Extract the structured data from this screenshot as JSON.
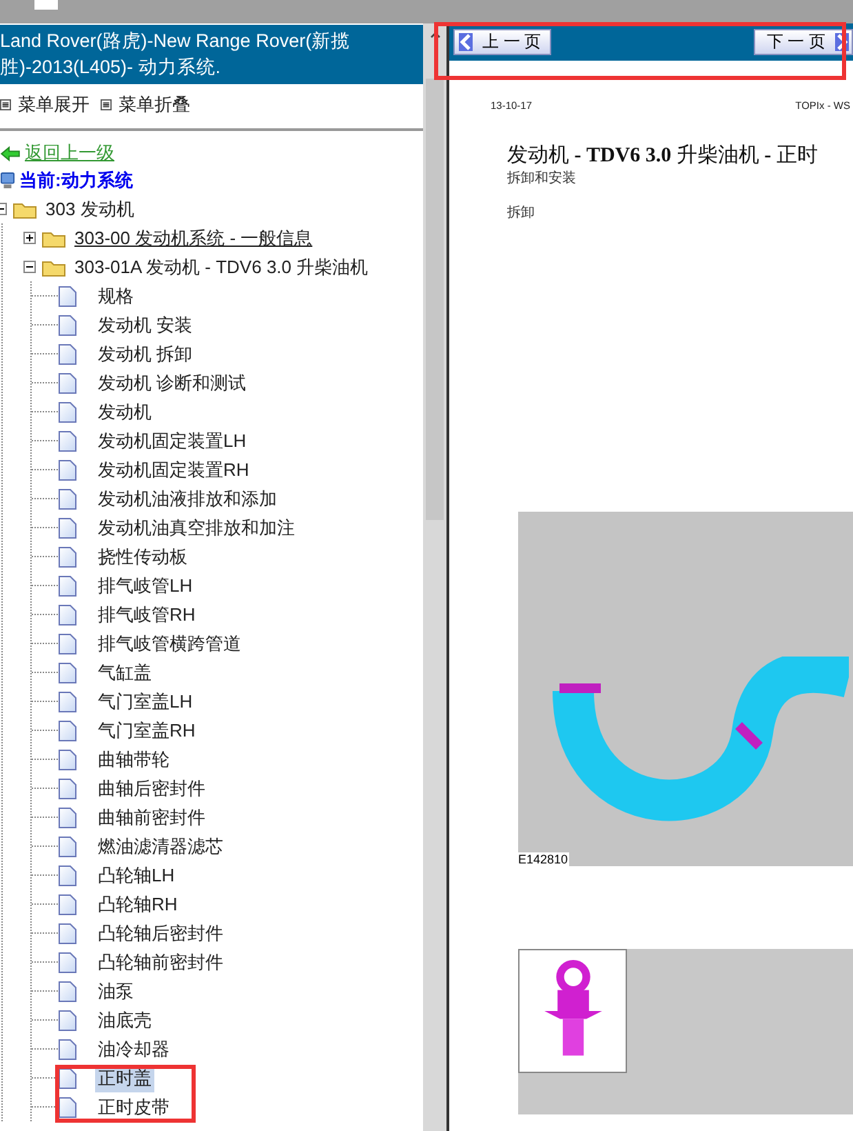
{
  "header": {
    "lines": [
      "Land Rover(路虎)-New Range Rover(新揽",
      "胜)-2013(L405)- 动力系统."
    ]
  },
  "menu_actions": [
    {
      "label": "菜单展开"
    },
    {
      "label": "菜单折叠"
    }
  ],
  "back_link": "返回上一级",
  "current": "当前:动力系统",
  "tree": [
    {
      "label": "303 发动机",
      "expanded": true,
      "underlined": false,
      "children": [
        {
          "label": "303-00 发动机系统 - 一般信息",
          "expanded": false,
          "underlined": true
        },
        {
          "label": "303-01A 发动机 - TDV6 3.0 升柴油机",
          "expanded": true,
          "underlined": false,
          "children": [
            {
              "label": "规格",
              "selected": false
            },
            {
              "label": "发动机 安装",
              "selected": false
            },
            {
              "label": "发动机 拆卸",
              "selected": false
            },
            {
              "label": "发动机 诊断和测试",
              "selected": false
            },
            {
              "label": "发动机",
              "selected": false
            },
            {
              "label": "发动机固定装置LH",
              "selected": false
            },
            {
              "label": "发动机固定装置RH",
              "selected": false
            },
            {
              "label": "发动机油液排放和添加",
              "selected": false
            },
            {
              "label": "发动机油真空排放和加注",
              "selected": false
            },
            {
              "label": "挠性传动板",
              "selected": false
            },
            {
              "label": "排气岐管LH",
              "selected": false
            },
            {
              "label": "排气岐管RH",
              "selected": false
            },
            {
              "label": "排气岐管横跨管道",
              "selected": false
            },
            {
              "label": "气缸盖",
              "selected": false
            },
            {
              "label": "气门室盖LH",
              "selected": false
            },
            {
              "label": "气门室盖RH",
              "selected": false
            },
            {
              "label": "曲轴带轮",
              "selected": false
            },
            {
              "label": "曲轴后密封件",
              "selected": false
            },
            {
              "label": "曲轴前密封件",
              "selected": false
            },
            {
              "label": "燃油滤清器滤芯",
              "selected": false
            },
            {
              "label": "凸轮轴LH",
              "selected": false
            },
            {
              "label": "凸轮轴RH",
              "selected": false
            },
            {
              "label": "凸轮轴后密封件",
              "selected": false
            },
            {
              "label": "凸轮轴前密封件",
              "selected": false
            },
            {
              "label": "油泵",
              "selected": false
            },
            {
              "label": "油底壳",
              "selected": false
            },
            {
              "label": "油冷却器",
              "selected": false
            },
            {
              "label": "正时盖",
              "selected": true
            },
            {
              "label": "正时皮带",
              "selected": false
            }
          ]
        }
      ]
    }
  ],
  "nav": {
    "prev": "上 一 页",
    "next": "下 一 页"
  },
  "document": {
    "date": "13-10-17",
    "source": "TOPIx - WS",
    "title": "发动机 **- TDV6 3.0** 升柴油机 **-** 正时",
    "subtitle": "拆卸和安装",
    "section": "拆卸",
    "figure_caption": "E142810"
  }
}
